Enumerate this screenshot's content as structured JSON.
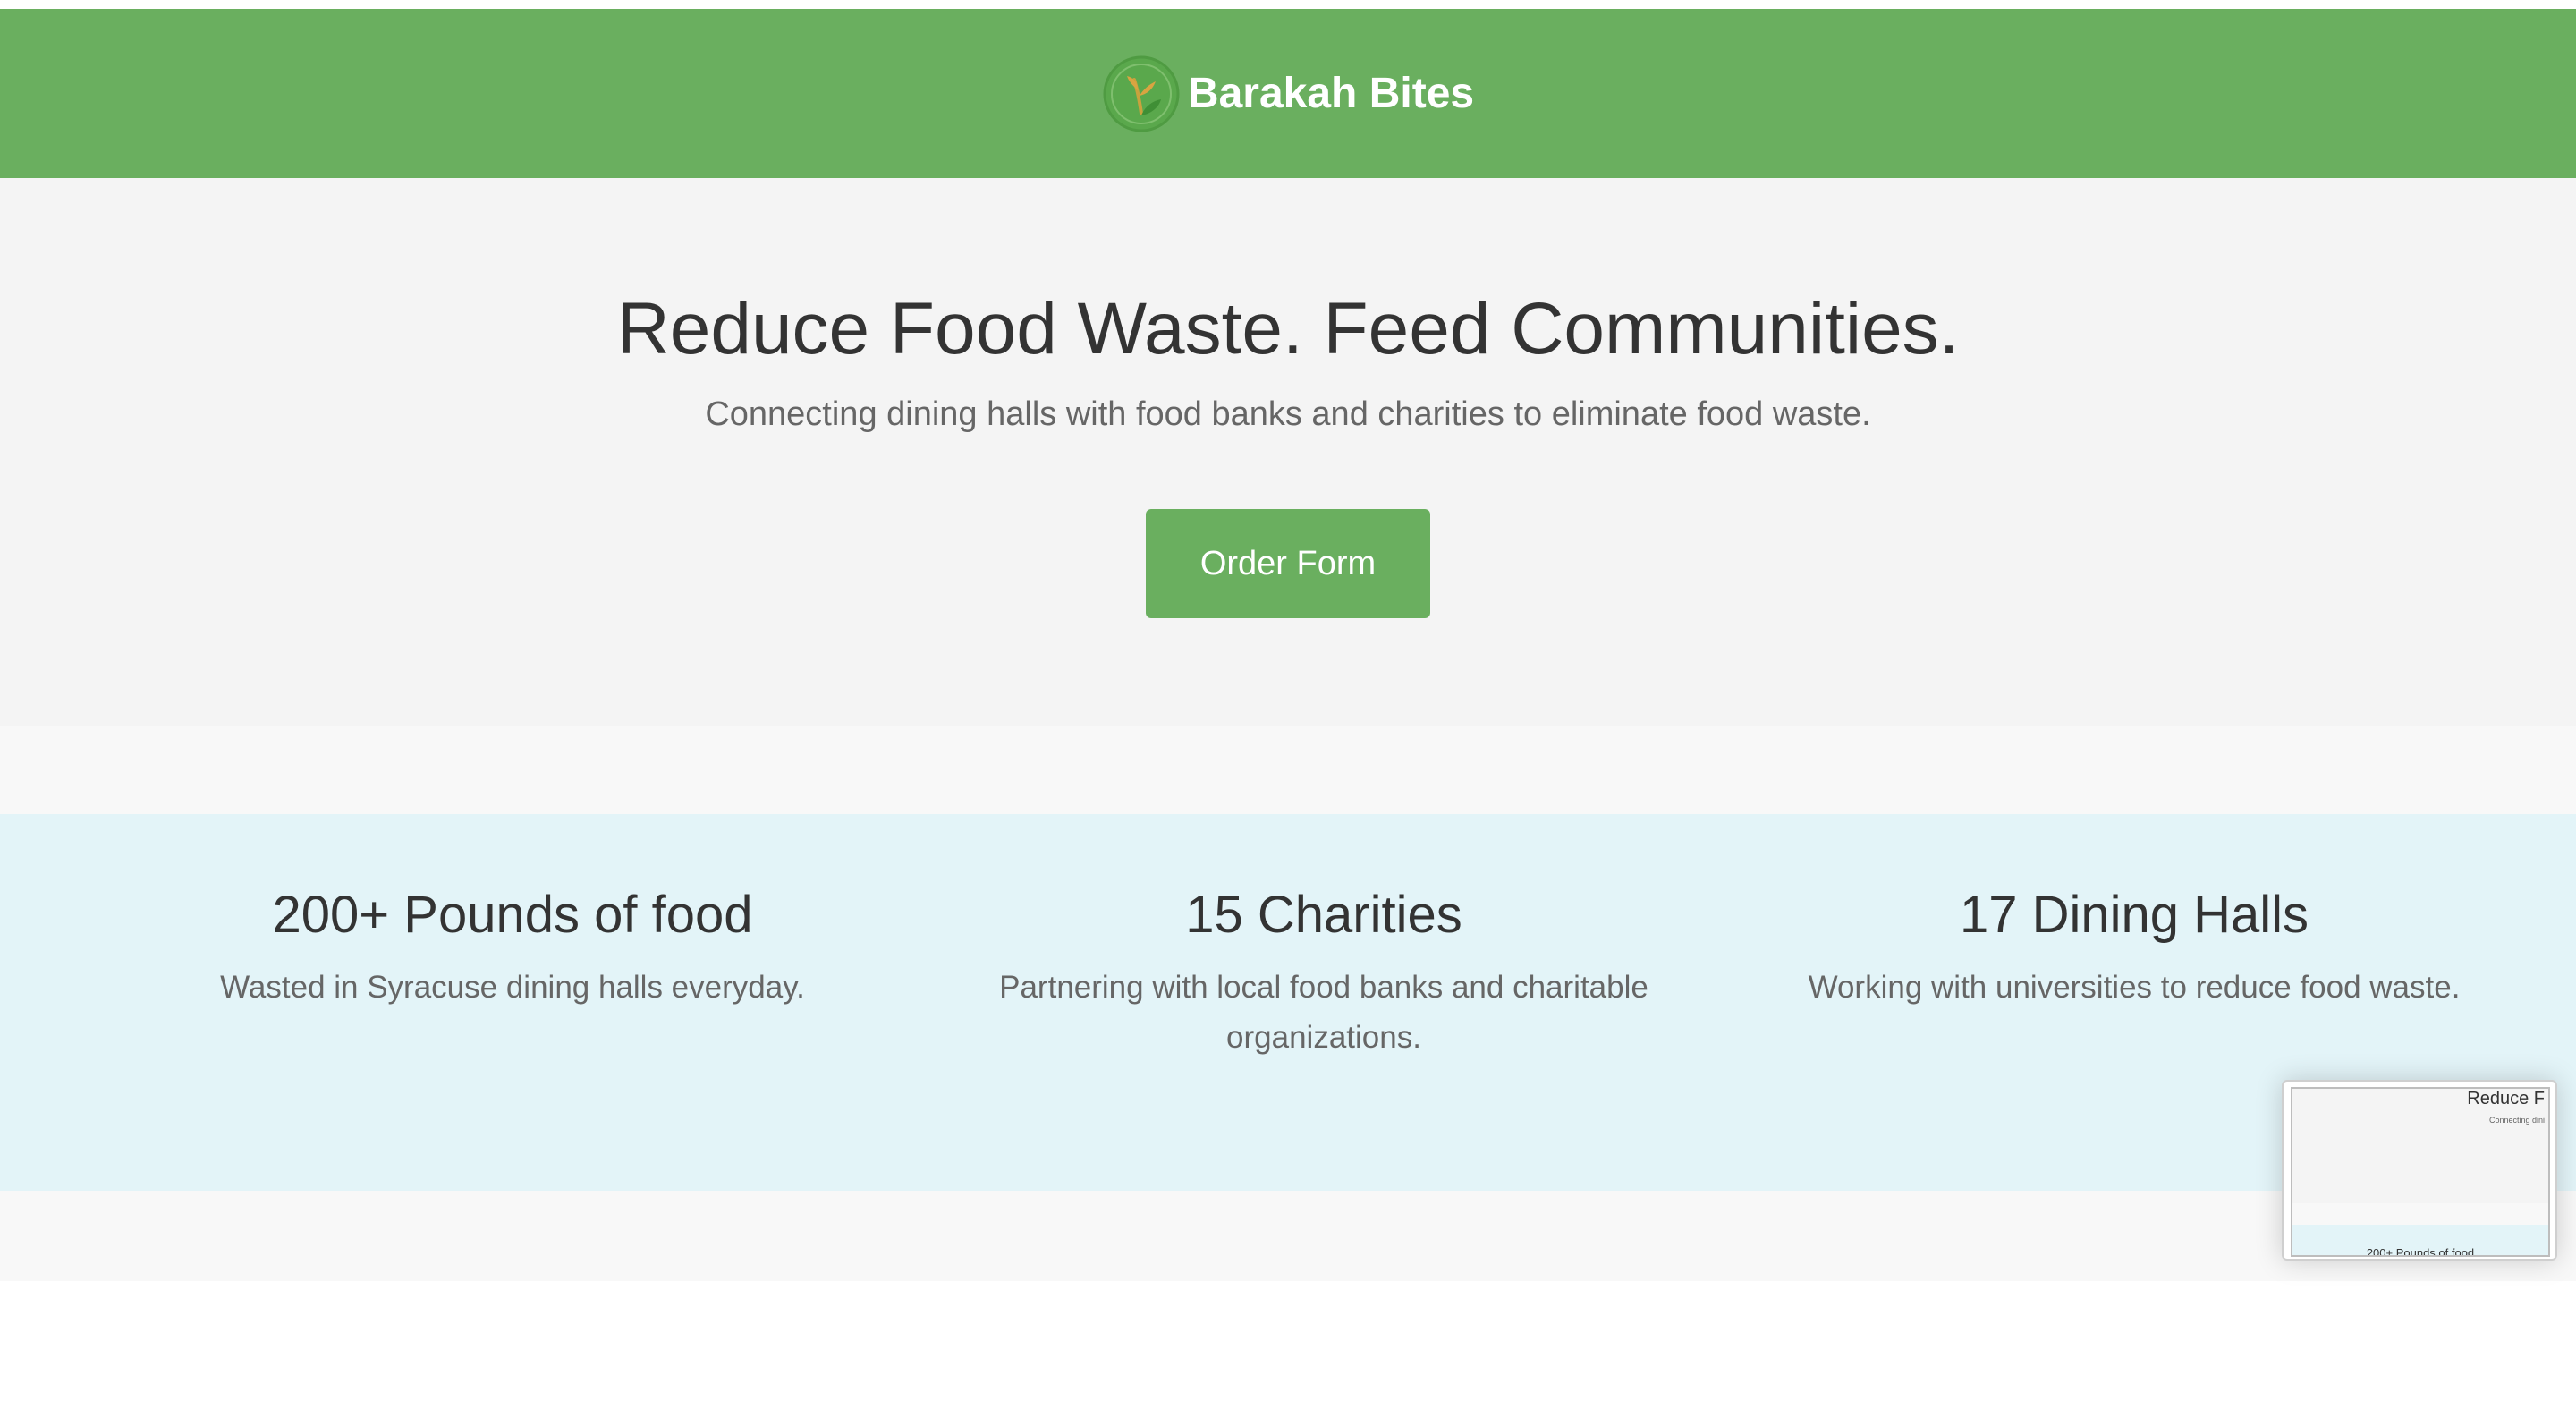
{
  "header": {
    "brand_name": "Barakah Bites",
    "logo_icon": "sprout-leaf-icon",
    "background_color": "#6aaf5f"
  },
  "hero": {
    "title": "Reduce Food Waste. Feed Communities.",
    "subtitle": "Connecting dining halls with food banks and charities to eliminate food waste.",
    "cta_label": "Order Form"
  },
  "stats": [
    {
      "heading": "200+ Pounds of food",
      "text": "Wasted in Syracuse dining halls everyday."
    },
    {
      "heading": "15 Charities",
      "text": "Partnering with local food banks and charitable organizations."
    },
    {
      "heading": "17 Dining Halls",
      "text": "Working with universities to reduce food waste."
    }
  ],
  "minimap": {
    "title_fragment": "Reduce F",
    "subtitle_fragment": "Connecting dini",
    "stat_fragment": "200+ Pounds of food"
  },
  "colors": {
    "brand_green": "#6aaf5f",
    "hero_bg": "#f4f4f4",
    "stats_bg": "#e3f4f8",
    "text_dark": "#333333",
    "text_muted": "#666666"
  }
}
